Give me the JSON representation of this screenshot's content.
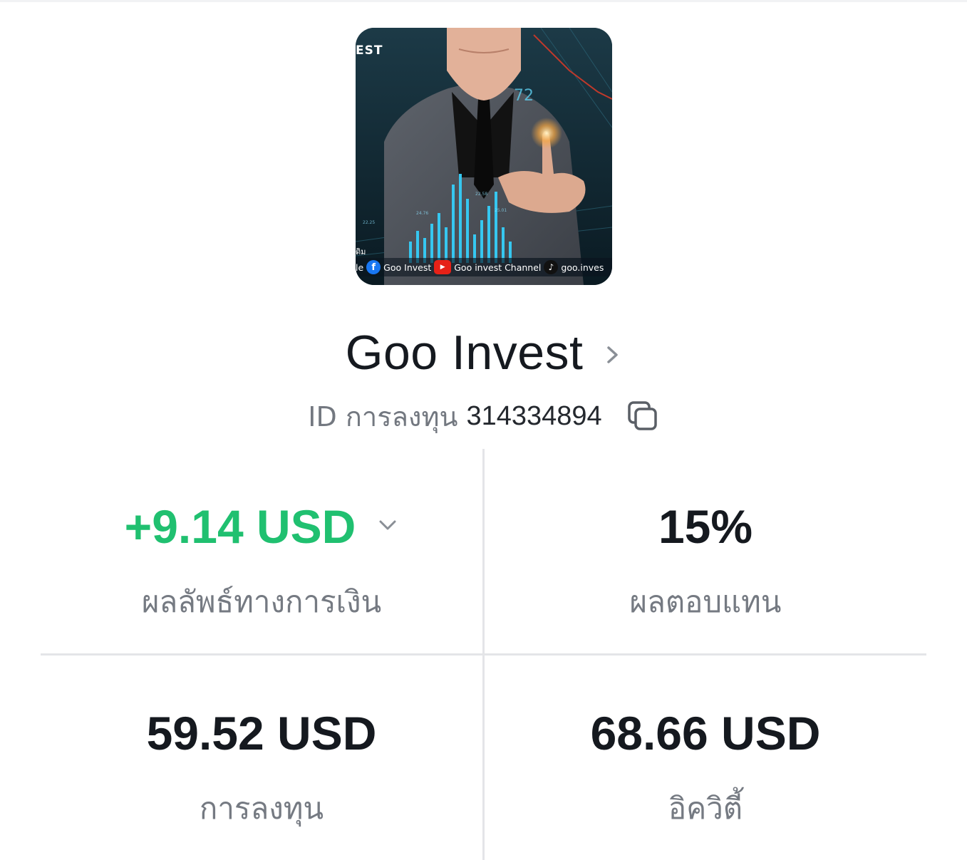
{
  "profile": {
    "avatar_banner": {
      "corner_text": "EST",
      "fb_label": "Goo Invest",
      "youtube_label": "Goo invest Channel",
      "tiktok_label": "goo.inves"
    },
    "name": "Goo Invest",
    "id_label": "ID การลงทุน",
    "id_value": "314334894"
  },
  "stats": [
    {
      "value": "+9.14 USD",
      "label": "ผลลัพธ์ทางการเงิน",
      "color": "#20c070",
      "has_dropdown": true
    },
    {
      "value": "15%",
      "label": "ผลตอบแทน"
    },
    {
      "value": "59.52 USD",
      "label": "การลงทุน"
    },
    {
      "value": "68.66 USD",
      "label": "อิควิตี้"
    }
  ],
  "icons": {
    "name_chevron": "chevron-right-icon",
    "copy": "copy-icon",
    "dropdown": "chevron-down-icon"
  },
  "colors": {
    "positive": "#20c070",
    "text_primary": "#15191f",
    "text_secondary": "#757a82",
    "divider": "#e4e5e8"
  }
}
